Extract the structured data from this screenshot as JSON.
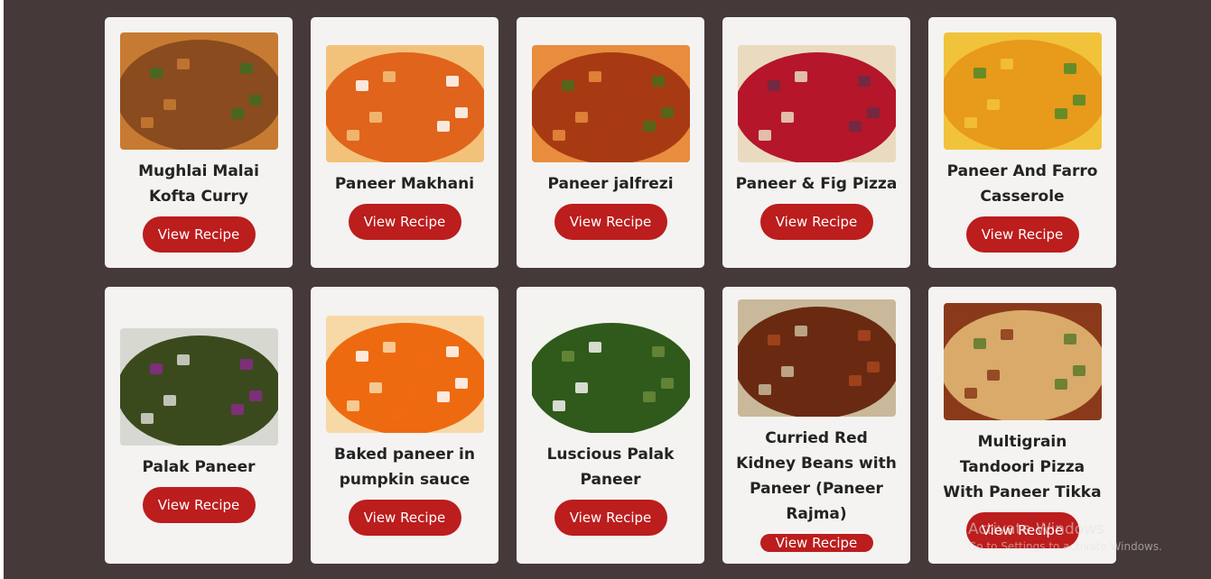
{
  "recipes": [
    {
      "title": "Mughlai Malai Kofta Curry",
      "button": "View Recipe",
      "image_colors": [
        "#8a4b1e",
        "#c77a32",
        "#3f6b22"
      ]
    },
    {
      "title": "Paneer Makhani",
      "button": "View Recipe",
      "image_colors": [
        "#e0641c",
        "#f3c27a",
        "#ffffff"
      ]
    },
    {
      "title": "Paneer jalfrezi",
      "button": "View Recipe",
      "image_colors": [
        "#a83a13",
        "#e88d3e",
        "#4a6c1b"
      ]
    },
    {
      "title": "Paneer & Fig Pizza",
      "button": "View Recipe",
      "image_colors": [
        "#b5162a",
        "#eadbc0",
        "#6a2b45"
      ]
    },
    {
      "title": "Paneer And Farro Casserole",
      "button": "View Recipe",
      "image_colors": [
        "#e89a1a",
        "#f1c33a",
        "#4f8a2a"
      ]
    },
    {
      "title": "Palak Paneer",
      "button": "View Recipe",
      "image_colors": [
        "#3b4a1c",
        "#d8d8d2",
        "#8a2a8a"
      ]
    },
    {
      "title": "Baked paneer in pumpkin sauce",
      "button": "View Recipe",
      "image_colors": [
        "#ee6a10",
        "#f7d9a8",
        "#ffffff"
      ]
    },
    {
      "title": "Luscious Palak Paneer",
      "button": "View Recipe",
      "image_colors": [
        "#2f5a1b",
        "#f3f3f0",
        "#6b8a3a"
      ]
    },
    {
      "title": "Curried Red Kidney Beans with Paneer (Paneer Rajma)",
      "button": "View Recipe",
      "image_colors": [
        "#6a2a12",
        "#c9b99a",
        "#a8451d"
      ]
    },
    {
      "title": "Multigrain Tandoori Pizza With Paneer Tikka",
      "button": "View Recipe",
      "image_colors": [
        "#d9aa6a",
        "#8a3a1a",
        "#5a7a2a"
      ]
    }
  ],
  "watermark": {
    "title": "Activate Windows",
    "subtitle": "Go to Settings to activate Windows."
  },
  "colors": {
    "background": "#463939",
    "card": "#f4f3f1",
    "button": "#bc1d1d",
    "text": "#232323"
  }
}
